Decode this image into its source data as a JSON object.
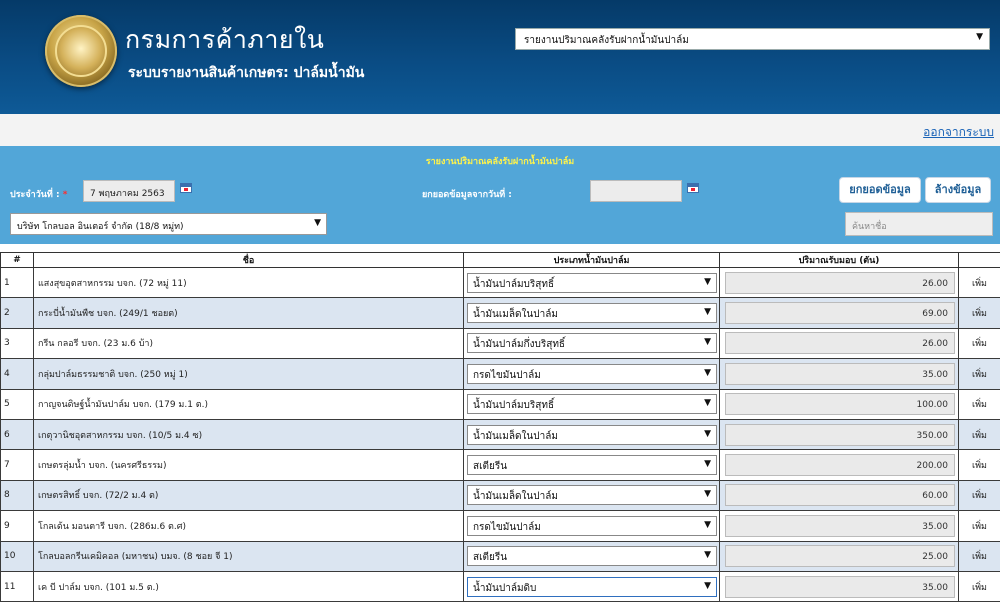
{
  "header": {
    "org_name": "กรมการค้าภายใน",
    "system_name": "ระบบรายงานสินค้าเกษตร: ปาล์มน้ำมัน",
    "report_select_value": "รายงานปริมาณคลังรับฝากน้ำมันปาล์ม"
  },
  "topbar": {
    "logout_label": "ออกจากระบบ"
  },
  "panel": {
    "title": "รายงานปริมาณคลังรับฝากน้ำมันปาล์ม",
    "date_label": "ประจำวันที่ :",
    "required_mark": "*",
    "date_value": "7 พฤษภาคม 2563",
    "copy_from_label": "ยกยอดข้อมูลจากวันที่ :",
    "copy_from_value": "",
    "copy_button": "ยกยอดข้อมูล",
    "clear_button": "ล้างข้อมูล",
    "company_value": "บริษัท โกลบอล อินเตอร์ จำกัด (18/8 หมู่ท)",
    "search_placeholder": "ค้นหาชื่อ"
  },
  "table": {
    "headers": [
      "#",
      "ชื่อ",
      "ประเภทน้ำมันปาล์ม",
      "ปริมาณรับมอบ (ตัน)",
      ""
    ],
    "add_label": "เพิ่ม",
    "rows": [
      {
        "no": "1",
        "name": "แสงสุขอุตสาหกรรม บจก. (72 หมู่ 11)",
        "type": "น้ำมันปาล์มบริสุทธิ์",
        "amount": "26.00"
      },
      {
        "no": "2",
        "name": "กระบี่น้ำมันพืช บจก. (249/1 ชอยต)",
        "type": "น้ำมันเมล็ดในปาล์ม",
        "amount": "69.00"
      },
      {
        "no": "3",
        "name": "กรีน กลอรี บจก. (23 ม.6 บ้า)",
        "type": "น้ำมันปาล์มกึ่งบริสุทธิ์",
        "amount": "26.00"
      },
      {
        "no": "4",
        "name": "กลุ่มปาล์มธรรมชาติ บจก. (250 หมู่ 1)",
        "type": "กรดไขมันปาล์ม",
        "amount": "35.00"
      },
      {
        "no": "5",
        "name": "กาญจนดิษฐ์น้ำมันปาล์ม บจก. (179 ม.1 ต.)",
        "type": "น้ำมันปาล์มบริสุทธิ์",
        "amount": "100.00"
      },
      {
        "no": "6",
        "name": "เกตุวานิชอุตสาหกรรม บจก. (10/5 ม.4 ซ)",
        "type": "น้ำมันเมล็ดในปาล์ม",
        "amount": "350.00"
      },
      {
        "no": "7",
        "name": "เกษตรลุ่มน้ำ บจก. (นครศรีธรรม)",
        "type": "สเตียรีน",
        "amount": "200.00"
      },
      {
        "no": "8",
        "name": "เกษตรสิทธิ์ บจก. (72/2 ม.4 ต)",
        "type": "น้ำมันเมล็ดในปาล์ม",
        "amount": "60.00"
      },
      {
        "no": "9",
        "name": "โกลเด้น มอนตารี บจก. (286ม.6 ต.ศ)",
        "type": "กรดไขมันปาล์ม",
        "amount": "35.00"
      },
      {
        "no": "10",
        "name": "โกลบอลกรีนเคมิคอล (มหาชน) บมจ. (8 ชอย จี 1)",
        "type": "สเตียรีน",
        "amount": "25.00"
      },
      {
        "no": "11",
        "name": "เค บี ปาล์ม บจก. (101 ม.5 ต.)",
        "type": "น้ำมันปาล์มดิบ",
        "amount": "35.00"
      }
    ]
  }
}
